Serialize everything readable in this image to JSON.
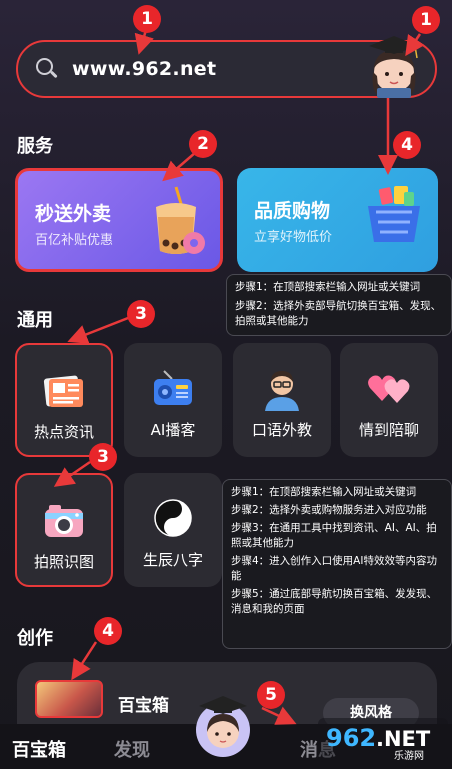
{
  "search": {
    "url": "www.962.net"
  },
  "sections": {
    "service": "服务",
    "general": "通用",
    "create": "创作"
  },
  "services": [
    {
      "title": "秒送外卖",
      "subtitle": "百亿补贴优惠"
    },
    {
      "title": "品质购物",
      "subtitle": "立享好物低价"
    }
  ],
  "tools": [
    {
      "label": "热点资讯"
    },
    {
      "label": "AI播客"
    },
    {
      "label": "口语外教"
    },
    {
      "label": "情到陪聊"
    },
    {
      "label": "拍照识图"
    },
    {
      "label": "生辰八字"
    }
  ],
  "tip_top": [
    "步骤1：在顶部搜索栏输入网址或关键词",
    "步骤2：选择外卖部导航切换百宝箱、发现、拍照或其他能力"
  ],
  "tip_bottom": [
    "步骤1：在顶部搜索栏输入网址或关键词",
    "步骤2：选择外卖或购物服务进入对应功能",
    "步骤3：在通用工具中找到资讯、AI、AI、拍照或其他能力",
    "步骤4：进入创作入口使用AI特效效等内容功能",
    "步骤5：通过底部导航切换百宝箱、发发现、消息和我的页面"
  ],
  "creation": {
    "title": "百宝箱",
    "button": "换风格"
  },
  "nav": {
    "home": "百宝箱",
    "discover": "发现",
    "message": "消息"
  },
  "badges": [
    "1",
    "1",
    "2",
    "4",
    "3",
    "3",
    "4",
    "5"
  ],
  "watermark": {
    "brand": "962",
    "suffix": ".NET",
    "sub": "乐游网"
  },
  "colors": {
    "annotation": "#e8393a",
    "delivery": "#7d66ee",
    "shopping": "#34aee6"
  }
}
